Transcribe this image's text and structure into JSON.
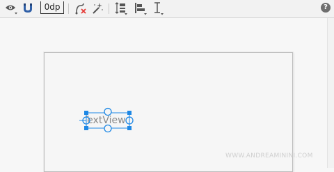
{
  "toolbar": {
    "icons": [
      "eye-icon",
      "magnet-icon",
      "clear-constraints-icon",
      "magic-wand-icon",
      "pack-icon",
      "align-icon",
      "guidelines-icon",
      "help-icon"
    ],
    "default_margin": "0dp",
    "help_label": "?"
  },
  "canvas": {
    "widget_text": "TextView"
  },
  "watermark": "WWW.ANDREAMININI.COM",
  "colors": {
    "accent": "#1e88e5",
    "toolbar_bg": "#f2f2f2",
    "canvas_bg": "#f6f6f6"
  }
}
